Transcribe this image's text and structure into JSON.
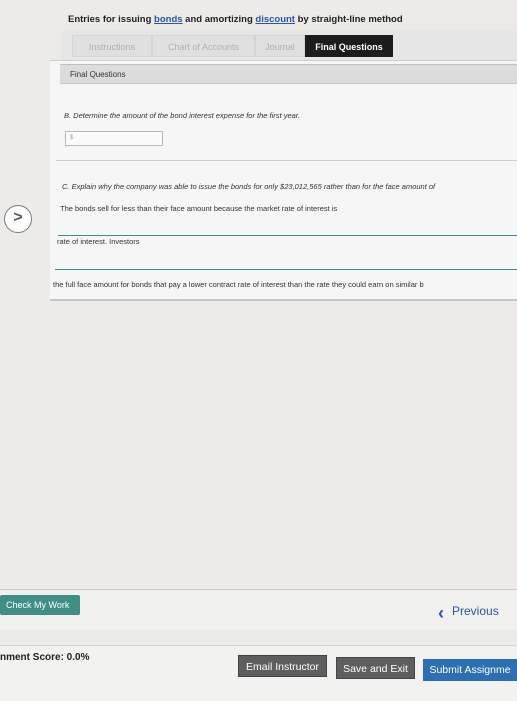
{
  "header": {
    "title_part1": "Entries for issuing ",
    "title_link1": "bonds",
    "title_part2": " and amortizing ",
    "title_link2": "discount",
    "title_part3": " by straight-line method"
  },
  "tabs": [
    {
      "label": "Instructions"
    },
    {
      "label": "Chart of Accounts"
    },
    {
      "label": "Journal"
    },
    {
      "label": "Final Questions"
    }
  ],
  "panel": {
    "title": "Final Questions",
    "question_b": "B. Determine the amount of the bond interest expense for the first year.",
    "input_b_value": "$",
    "question_c": "C. Explain why the company was able to issue the bonds for only $23,012,565 rather than for the face amount of",
    "answer_line1": "The bonds sell for less than their face amount because the market rate of interest is",
    "answer_line2": "rate of interest. Investors",
    "answer_line3": "the full face amount for bonds that pay a lower contract rate of interest than the rate they could earn on similar b"
  },
  "nav": {
    "left_arrow": ">",
    "check_my_work": "Check My Work",
    "previous": "Previous"
  },
  "footer": {
    "score": "nment Score: 0.0%",
    "email_instructor": "Email Instructor",
    "save_and_exit": "Save and Exit",
    "submit": "Submit Assignme"
  },
  "colors": {
    "link": "#2a55a8",
    "accent_teal": "#3f8f86",
    "submit_blue": "#2c6fb3",
    "tab_active": "#1c1c1c"
  }
}
